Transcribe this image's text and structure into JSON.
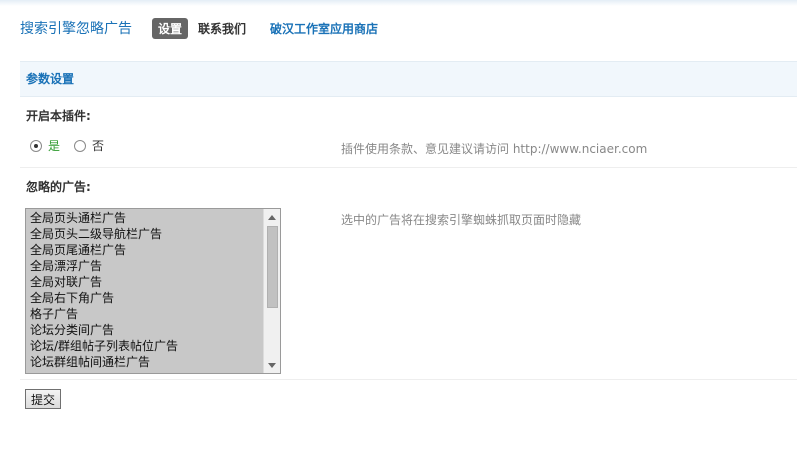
{
  "header": {
    "plugin_title": "搜索引擎忽略广告",
    "tabs": [
      {
        "label": "设置",
        "active": true
      },
      {
        "label": "联系我们",
        "active": false
      }
    ],
    "store_link": "破汉工作室应用商店"
  },
  "section": {
    "title": "参数设置"
  },
  "enable": {
    "label": "开启本插件:",
    "options": [
      {
        "label": "是",
        "checked": true
      },
      {
        "label": "否",
        "checked": false
      }
    ],
    "tip": "插件使用条款、意见建议请访问 http://www.nciaer.com"
  },
  "ignore": {
    "label": "忽略的广告:",
    "items": [
      "全局页头通栏广告",
      "全局页头二级导航栏广告",
      "全局页尾通栏广告",
      "全局漂浮广告",
      "全局对联广告",
      "全局右下角广告",
      "格子广告",
      "论坛分类间广告",
      "论坛/群组帖子列表帖位广告",
      "论坛群组帖间通栏广告"
    ],
    "tip": "选中的广告将在搜索引擎蜘蛛抓取页面时隐藏"
  },
  "submit": {
    "label": "提交"
  },
  "colors": {
    "accent": "#1a72b7",
    "section_bg": "#f1f7fc",
    "yes_green": "#2e9a2e"
  }
}
